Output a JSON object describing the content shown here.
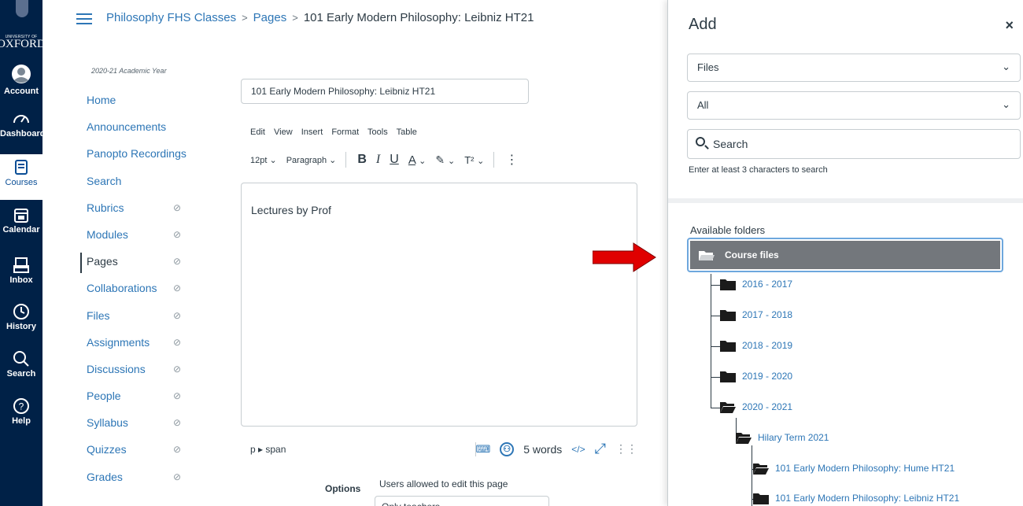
{
  "global_nav": {
    "logo": {
      "small_text": "UNIVERSITY OF",
      "big_text": "OXFORD"
    },
    "items": [
      {
        "label": "Account",
        "icon": "account-icon"
      },
      {
        "label": "Dashboard",
        "icon": "dashboard-icon"
      },
      {
        "label": "Courses",
        "icon": "courses-icon",
        "active": true
      },
      {
        "label": "Calendar",
        "icon": "calendar-icon"
      },
      {
        "label": "Inbox",
        "icon": "inbox-icon"
      },
      {
        "label": "History",
        "icon": "history-icon"
      },
      {
        "label": "Search",
        "icon": "search-icon"
      },
      {
        "label": "Help",
        "icon": "help-icon"
      }
    ]
  },
  "breadcrumb": {
    "course": "Philosophy FHS Classes",
    "section": "Pages",
    "current": "101 Early Modern Philosophy: Leibniz HT21",
    "separator": ">"
  },
  "course_nav": {
    "year_label": "2020-21 Academic Year",
    "items": [
      {
        "label": "Home",
        "hidden": false
      },
      {
        "label": "Announcements",
        "hidden": false
      },
      {
        "label": "Panopto Recordings",
        "hidden": false
      },
      {
        "label": "Search",
        "hidden": false
      },
      {
        "label": "Rubrics",
        "hidden": true
      },
      {
        "label": "Modules",
        "hidden": true
      },
      {
        "label": "Pages",
        "hidden": true,
        "selected": true
      },
      {
        "label": "Collaborations",
        "hidden": true
      },
      {
        "label": "Files",
        "hidden": true
      },
      {
        "label": "Assignments",
        "hidden": true
      },
      {
        "label": "Discussions",
        "hidden": true
      },
      {
        "label": "People",
        "hidden": true
      },
      {
        "label": "Syllabus",
        "hidden": true
      },
      {
        "label": "Quizzes",
        "hidden": true
      },
      {
        "label": "Grades",
        "hidden": true
      }
    ]
  },
  "editor": {
    "title_value": "101 Early Modern Philosophy: Leibniz HT21",
    "menu": [
      "Edit",
      "View",
      "Insert",
      "Format",
      "Tools",
      "Table"
    ],
    "toolbar": {
      "font_size": "12pt",
      "block": "Paragraph",
      "bold": "B",
      "italic": "I",
      "underline": "U",
      "text_color": "A",
      "highlight": "✎",
      "superscript": "T²",
      "more": "⋮"
    },
    "body_text": "Lectures by Prof",
    "status": {
      "path": "p ▸ span",
      "word_count": "5 words",
      "code": "</>"
    },
    "options_label": "Options",
    "options_text": "Users allowed to edit this page",
    "options_select": "Only teachers"
  },
  "panel": {
    "title": "Add",
    "close": "×",
    "type_select": "Files",
    "filter_select": "All",
    "search_placeholder": "Search",
    "search_hint": "Enter at least 3 characters to search",
    "available_label": "Available folders",
    "root_folder": "Course files",
    "folders": [
      {
        "label": "2016 - 2017",
        "level": 1,
        "open": false
      },
      {
        "label": "2017 - 2018",
        "level": 1,
        "open": false
      },
      {
        "label": "2018 - 2019",
        "level": 1,
        "open": false
      },
      {
        "label": "2019 - 2020",
        "level": 1,
        "open": false
      },
      {
        "label": "2020 - 2021",
        "level": 1,
        "open": true
      },
      {
        "label": "Hilary Term 2021",
        "level": 2,
        "open": true
      },
      {
        "label": "101 Early Modern Philosophy: Hume HT21",
        "level": 3,
        "open": true
      },
      {
        "label": "101 Early Modern Philosophy: Leibniz HT21",
        "level": 3,
        "open": false
      }
    ]
  },
  "colors": {
    "nav_bg": "#002147",
    "link": "#2d76b6",
    "arrow": "#e00000",
    "selected_folder": "#73777c"
  }
}
